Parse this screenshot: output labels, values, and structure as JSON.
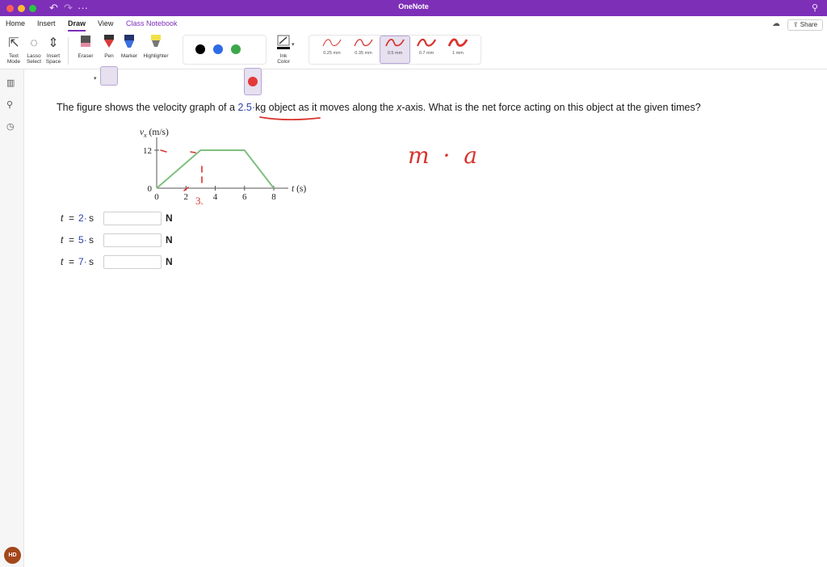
{
  "app": {
    "title": "OneNote"
  },
  "tabs": [
    {
      "label": "Home"
    },
    {
      "label": "Insert"
    },
    {
      "label": "Draw"
    },
    {
      "label": "View"
    },
    {
      "label": "Class Notebook"
    }
  ],
  "share_label": "Share",
  "ribbon": {
    "tools": [
      {
        "label_1": "Text",
        "label_2": "Mode",
        "icon": "text-mode-icon"
      },
      {
        "label_1": "Lasso",
        "label_2": "Select",
        "icon": "lasso-icon"
      },
      {
        "label_1": "Insert",
        "label_2": "Space",
        "icon": "insert-space-icon"
      }
    ],
    "pens": [
      {
        "label": "Eraser"
      },
      {
        "label": "Pen"
      },
      {
        "label": "Marker"
      },
      {
        "label": "Highlighter"
      }
    ],
    "colors": [
      "#000000",
      "#2f6be6",
      "#3aa84a",
      "#e23a3a"
    ],
    "ink_color": {
      "label_1": "Ink",
      "label_2": "Color"
    },
    "thickness": [
      "0.25 mm",
      "0.35 mm",
      "0.5 mm",
      "0.7 mm",
      "1 mm"
    ],
    "selected_thickness": "0.5 mm"
  },
  "user": {
    "initials": "HD"
  },
  "question": {
    "part1": "The figure shows the velocity graph of a ",
    "mass": "2.5",
    "dot1": "·",
    "mass_unit": "kg",
    "part2": " object as it moves along the ",
    "axis_var": "x",
    "part3": "-axis. What is the net force acting on this object at the given times?"
  },
  "chart_data": {
    "type": "line",
    "x": [
      0,
      3,
      6,
      8
    ],
    "y": [
      0,
      12,
      12,
      0
    ],
    "ylabel_var": "v",
    "ylabel_sub": "x",
    "ylabel_unit": "(m/s)",
    "xlabel_var": "t",
    "xlabel_unit": "(s)",
    "xticks": [
      "0",
      "2",
      "4",
      "6",
      "8"
    ],
    "yticks": [
      "0",
      "12"
    ],
    "xlim": [
      0,
      8
    ],
    "ylim": [
      0,
      12
    ],
    "line_color": "#7fbf7f"
  },
  "answers": [
    {
      "var": "t",
      "eq": "=",
      "value": "2",
      "dot": "·",
      "unit": "s",
      "input_value": "",
      "result_unit": "N"
    },
    {
      "var": "t",
      "eq": "=",
      "value": "5",
      "dot": "·",
      "unit": "s",
      "input_value": "",
      "result_unit": "N"
    },
    {
      "var": "t",
      "eq": "=",
      "value": "7",
      "dot": "·",
      "unit": "s",
      "input_value": "",
      "result_unit": "N"
    }
  ],
  "handwriting": {
    "graph_note": "3.",
    "formula": "m · a",
    "color": "#d8332e"
  }
}
